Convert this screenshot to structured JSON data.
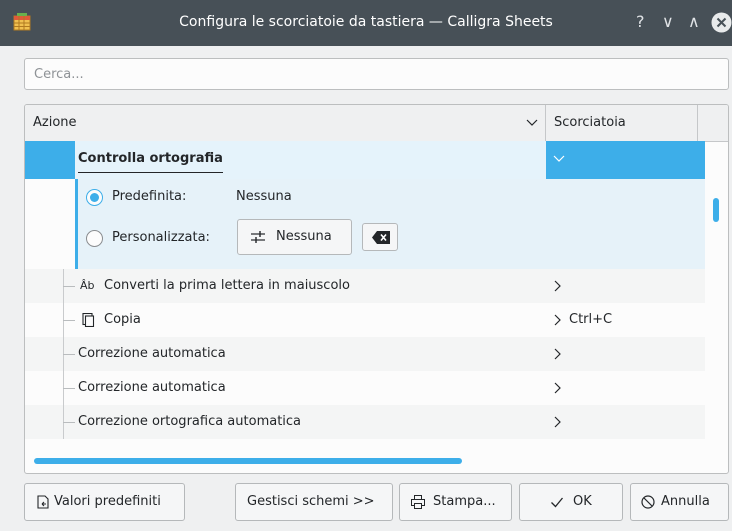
{
  "window": {
    "title": "Configura le scorciatoie da tastiera — Calligra Sheets",
    "help_glyph": "?",
    "minimize_glyph": "∨",
    "maximize_glyph": "∧"
  },
  "search": {
    "placeholder": "Cerca..."
  },
  "tree": {
    "columns": {
      "action": "Azione",
      "shortcut": "Scorciatoia"
    },
    "selected": {
      "label": "Controlla ortografia",
      "default_label": "Predefinita:",
      "default_value": "Nessuna",
      "custom_label": "Personalizzata:",
      "custom_button": "Nessuna",
      "selected_option": "default"
    },
    "rows": [
      {
        "label": "Converti la prima lettera in maiuscolo",
        "icon": "capitalize-icon",
        "icon_glyph": "Âb",
        "shortcut": ""
      },
      {
        "label": "Copia",
        "icon": "copy-icon",
        "shortcut": "Ctrl+C"
      },
      {
        "label": "Correzione automatica",
        "shortcut": ""
      },
      {
        "label": "Correzione automatica",
        "shortcut": ""
      },
      {
        "label": "Correzione ortografica automatica",
        "shortcut": ""
      }
    ]
  },
  "buttons": {
    "defaults": "Valori predefiniti",
    "schemes": "Gestisci schemi >>",
    "print": "Stampa...",
    "ok": "OK",
    "cancel": "Annulla"
  },
  "colors": {
    "accent": "#3daee9",
    "titlebar": "#475057"
  }
}
